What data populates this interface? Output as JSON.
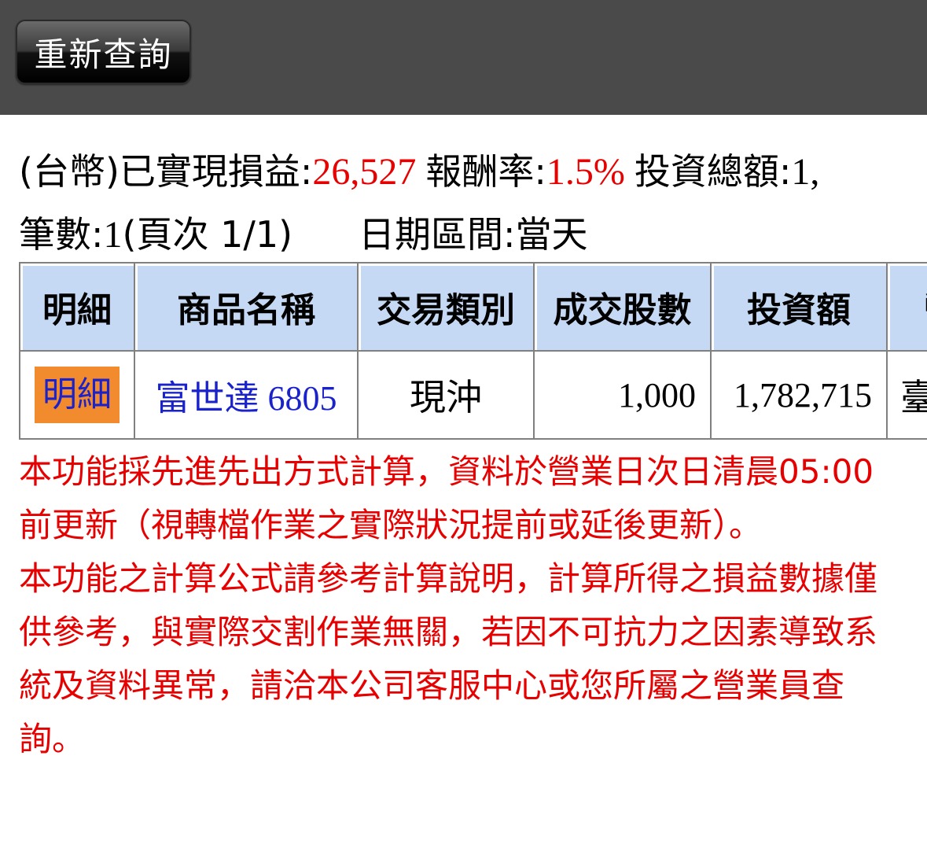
{
  "toolbar": {
    "requery_label": "重新查詢"
  },
  "summary": {
    "currency_prefix": "(台幣)",
    "realized_label": "已實現損益:",
    "realized_value": "26,527",
    "return_label": "報酬率:",
    "return_value": "1.5%",
    "invest_total_label": "投資總額:",
    "invest_total_value": "1,",
    "count_label": "筆數:",
    "count_value": "1",
    "page_label": "(頁次 1/1)",
    "date_label": "日期區間:",
    "date_value": "當天"
  },
  "table": {
    "headers": [
      "明細",
      "商品名稱",
      "交易類別",
      "成交股數",
      "投資額",
      "幣"
    ],
    "rows": [
      {
        "detail_label": "明細",
        "product_name": "富世達",
        "product_code": "6805",
        "trade_type": "現沖",
        "shares": "1,000",
        "amount": "1,782,715",
        "currency": "臺"
      }
    ]
  },
  "notes": {
    "line1": "本功能採先進先出方式計算，資料於營業日次日清晨05:00前更新（視轉檔作業之實際狀況提前或延後更新）。",
    "line2": "本功能之計算公式請參考計算說明，計算所得之損益數據僅供參考，與實際交割作業無關，若因不可抗力之因素導致系統及資料異常，請洽本公司客服中心或您所屬之營業員查詢。"
  },
  "colors": {
    "topbar": "#4a4a4a",
    "accent_red": "#e60000",
    "header_bg": "#c5d9f5",
    "link_blue": "#1a22cc",
    "detail_button": "#f28a2e"
  }
}
